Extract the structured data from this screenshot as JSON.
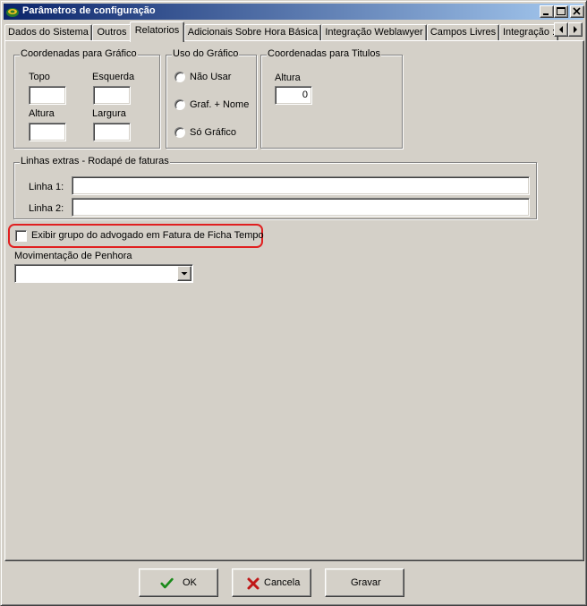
{
  "window": {
    "title": "Parâmetros de configuração",
    "icon": "app-logo-icon",
    "controls": [
      "minimize-icon",
      "maximize-icon",
      "close-icon"
    ]
  },
  "tabs": [
    {
      "label": "Dados do Sistema",
      "active": false
    },
    {
      "label": "Outros",
      "active": false
    },
    {
      "label": "Relatorios",
      "active": true
    },
    {
      "label": "Adicionais Sobre Hora Básica",
      "active": false
    },
    {
      "label": "Integração Weblawyer",
      "active": false
    },
    {
      "label": "Campos Livres",
      "active": false
    },
    {
      "label": "Integração :",
      "active": false
    }
  ],
  "coord_grafico": {
    "legend": "Coordenadas para Gráfico",
    "topo_label": "Topo",
    "esquerda_label": "Esquerda",
    "altura_label": "Altura",
    "largura_label": "Largura",
    "topo_value": "",
    "esquerda_value": "",
    "altura_value": "",
    "largura_value": ""
  },
  "uso_grafico": {
    "legend": "Uso do Gráfico",
    "options": [
      "Não Usar",
      "Graf. + Nome",
      "Só Gráfico"
    ]
  },
  "coord_titulos": {
    "legend": "Coordenadas para Titulos",
    "altura_label": "Altura",
    "altura_value": "0"
  },
  "linhas_extras": {
    "legend": "Linhas extras - Rodapé de faturas",
    "linha1_label": "Linha 1:",
    "linha2_label": "Linha 2:",
    "linha1_value": "",
    "linha2_value": ""
  },
  "exibir_grupo": {
    "label": "Exibir grupo do advogado em Fatura de Ficha Tempo",
    "checked": false,
    "highlight_color": "#e02020"
  },
  "movimentacao": {
    "label": "Movimentação de Penhora",
    "selected": ""
  },
  "buttons": {
    "ok": "OK",
    "cancela": "Cancela",
    "gravar": "Gravar"
  },
  "colors": {
    "face": "#d4d0c8",
    "title_start": "#0a246a",
    "title_end": "#a6caf0",
    "ok_check": "#1a8a1a",
    "cancel_x": "#c01818"
  }
}
